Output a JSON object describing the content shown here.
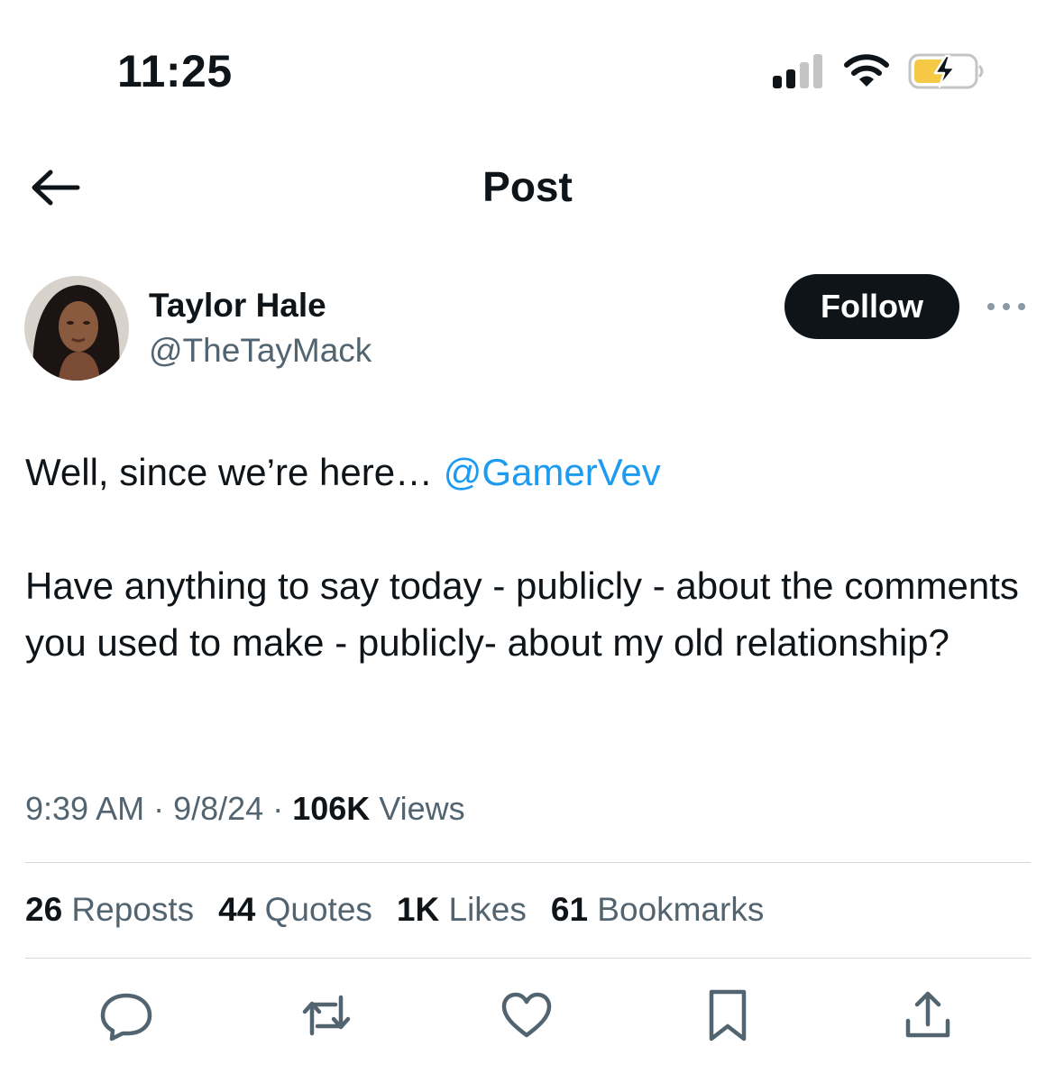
{
  "status_bar": {
    "time": "11:25",
    "icons": [
      "cellular-signal-icon",
      "wifi-icon",
      "battery-charging-icon"
    ],
    "battery_color": "#f5c945"
  },
  "header": {
    "title": "Post",
    "back_icon": "arrow-left-icon"
  },
  "author": {
    "name": "Taylor Hale",
    "handle": "@TheTayMack",
    "follow_label": "Follow",
    "more_icon": "more-horizontal-icon"
  },
  "tweet": {
    "line1_text": "Well, since we’re here… ",
    "mention": "@GamerVev",
    "paragraph2": "Have anything to say today - publicly - about the comments you used to make - publicly- about my old relationship?"
  },
  "meta": {
    "time": "9:39 AM",
    "sep1": " · ",
    "date": "9/8/24",
    "sep2": " · ",
    "views_count": "106K",
    "views_label": " Views"
  },
  "stats": {
    "reposts_count": "26",
    "reposts_label": " Reposts",
    "quotes_count": "44",
    "quotes_label": " Quotes",
    "likes_count": "1K",
    "likes_label": " Likes",
    "bookmarks_count": "61",
    "bookmarks_label": " Bookmarks"
  },
  "actions": [
    "reply-icon",
    "repost-icon",
    "like-icon",
    "bookmark-icon",
    "share-icon"
  ],
  "colors": {
    "text": "#0f1419",
    "secondary": "#536471",
    "link": "#1d9bf0",
    "divider": "#cfd9de",
    "follow_bg": "#0f1419"
  }
}
